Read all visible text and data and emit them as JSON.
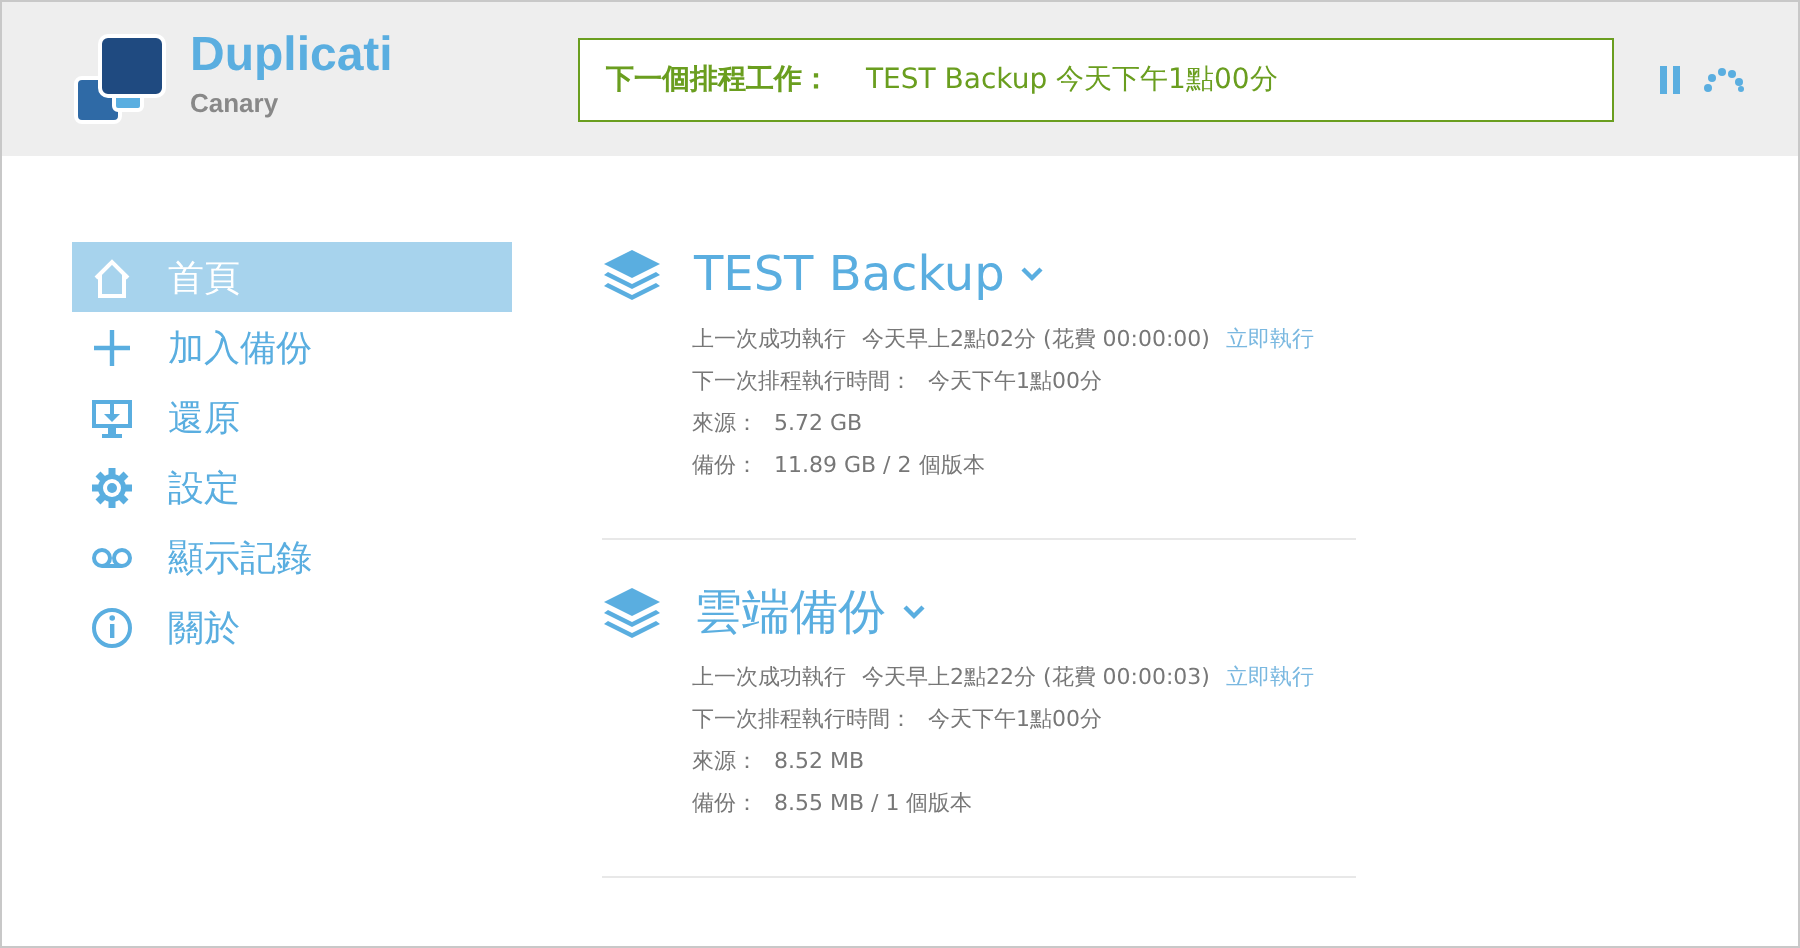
{
  "app": {
    "name": "Duplicati",
    "edition": "Canary"
  },
  "status": {
    "label": "下一個排程工作：",
    "value": "TEST Backup 今天下午1點00分"
  },
  "sidebar": {
    "items": [
      {
        "label": "首頁",
        "selected": true
      },
      {
        "label": "加入備份",
        "selected": false
      },
      {
        "label": "還原",
        "selected": false
      },
      {
        "label": "設定",
        "selected": false
      },
      {
        "label": "顯示記錄",
        "selected": false
      },
      {
        "label": "關於",
        "selected": false
      }
    ]
  },
  "backups": [
    {
      "name": "TEST Backup",
      "last_run_label": "上一次成功執行",
      "last_run": "今天早上2點02分 (花費 00:00:00)",
      "run_now": "立即執行",
      "next_label": "下一次排程執行時間：",
      "next": "今天下午1點00分",
      "source_label": "來源：",
      "source": "5.72 GB",
      "backup_label": "備份：",
      "backup": "11.89 GB / 2 個版本"
    },
    {
      "name": "雲端備份",
      "last_run_label": "上一次成功執行",
      "last_run": "今天早上2點22分 (花費 00:00:03)",
      "run_now": "立即執行",
      "next_label": "下一次排程執行時間：",
      "next": "今天下午1點00分",
      "source_label": "來源：",
      "source": "8.52 MB",
      "backup_label": "備份：",
      "backup": "8.55 MB / 1 個版本"
    }
  ]
}
